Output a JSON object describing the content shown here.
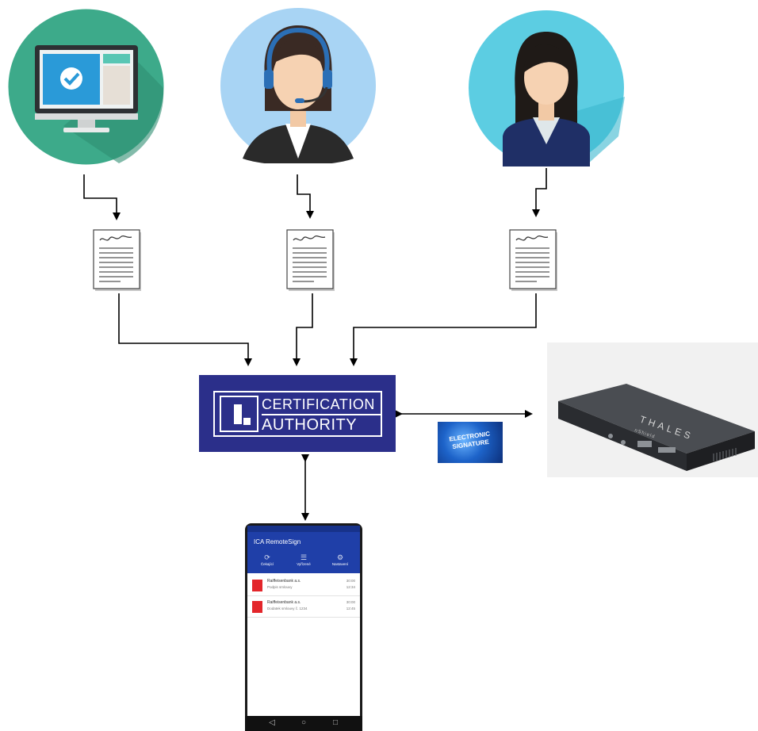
{
  "ca": {
    "line1": "CERTIFICATION",
    "line2": "AUTHORITY"
  },
  "badge": {
    "line1": "ELECTRONIC",
    "line2": "SIGNATURE"
  },
  "hsm": {
    "brand": "THALES",
    "sub": "nShield"
  },
  "phone_app": {
    "title": "ICA RemoteSign",
    "tabs": [
      "Čekající",
      "Vyřízené",
      "Nastavení"
    ],
    "rows": [
      {
        "name": "Raiffeisenbank a.s.",
        "desc": "Podpis smlouvy",
        "meta1": "30:00",
        "meta2": "12:34"
      },
      {
        "name": "Raiffeisenbank a.s.",
        "desc": "Dodatek smlouvy č. 1234",
        "meta1": "30:00",
        "meta2": "12:45"
      }
    ],
    "sys_buttons": [
      "◁",
      "○",
      "□"
    ]
  },
  "colors": {
    "ca_bg": "#2b2f8a",
    "app_blue": "#1f3fa8",
    "computer_circle": "#3daa8a",
    "operator_circle": "#a8d4f4",
    "person_circle": "#5ccde2"
  }
}
